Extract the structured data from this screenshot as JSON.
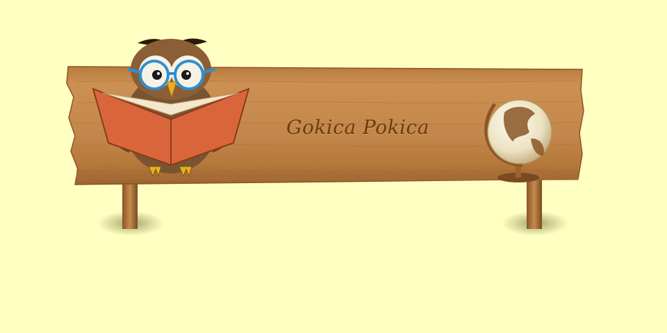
{
  "sign": {
    "title": "Gokica Pokica"
  },
  "colors": {
    "background": "#ffffc2",
    "wood": "#c58a4c",
    "wood_dark": "#8a5526",
    "title_text": "#6b3b10",
    "owl_body": "#7a5430",
    "book_cover": "#d9663a",
    "globe": "#f3ead0"
  },
  "icons": {
    "owl": "owl-reading-book-icon",
    "globe": "globe-icon"
  }
}
